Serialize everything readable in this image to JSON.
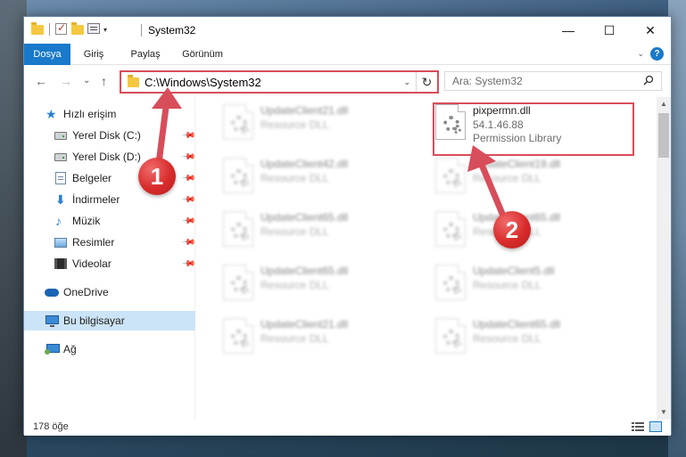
{
  "window": {
    "title": "System32",
    "controls": {
      "minimize": "—",
      "maximize": "☐",
      "close": "✕"
    }
  },
  "ribbon": {
    "tabs": [
      {
        "label": "Dosya",
        "active": true
      },
      {
        "label": "Giriş",
        "active": false
      },
      {
        "label": "Paylaş",
        "active": false
      },
      {
        "label": "Görünüm",
        "active": false
      }
    ],
    "help": "?"
  },
  "address": {
    "path": "C:\\Windows\\System32",
    "refresh": "↻",
    "dropdown": "⌄"
  },
  "search": {
    "placeholder": "Ara: System32"
  },
  "nav": {
    "back": "←",
    "forward": "→",
    "recent": "⌄",
    "up": "↑"
  },
  "sidebar": {
    "items": [
      {
        "label": "Hızlı erişim",
        "icon": "star-icon",
        "pinned": false
      },
      {
        "label": "Yerel Disk (C:)",
        "icon": "drive-icon",
        "pinned": true
      },
      {
        "label": "Yerel Disk (D:)",
        "icon": "drive-icon",
        "pinned": true
      },
      {
        "label": "Belgeler",
        "icon": "documents-icon",
        "pinned": true
      },
      {
        "label": "İndirmeler",
        "icon": "download-icon",
        "pinned": true
      },
      {
        "label": "Müzik",
        "icon": "music-icon",
        "pinned": true
      },
      {
        "label": "Resimler",
        "icon": "pictures-icon",
        "pinned": true
      },
      {
        "label": "Videolar",
        "icon": "videos-icon",
        "pinned": true
      },
      {
        "label": "OneDrive",
        "icon": "cloud-icon",
        "pinned": false
      },
      {
        "label": "Bu bilgisayar",
        "icon": "computer-icon",
        "pinned": false,
        "selected": true
      },
      {
        "label": "Ağ",
        "icon": "network-icon",
        "pinned": false
      }
    ]
  },
  "files": [
    {
      "name": "UpdateClient21.dll",
      "desc": "Resource DLL",
      "blurred": true
    },
    {
      "name": "pixpermn.dll",
      "version": "54.1.46.88",
      "desc": "Permission Library",
      "blurred": false
    },
    {
      "name": "UpdateClient42.dll",
      "desc": "Resource DLL",
      "blurred": true
    },
    {
      "name": "UpdateClient19.dll",
      "desc": "Resource DLL",
      "blurred": true
    },
    {
      "name": "UpdateClient65.dll",
      "desc": "Resource DLL",
      "blurred": true
    },
    {
      "name": "UpdateClient65.dll",
      "desc": "Resource DLL",
      "blurred": true
    },
    {
      "name": "UpdateClient65.dll",
      "desc": "Resource DLL",
      "blurred": true
    },
    {
      "name": "UpdateClient5.dll",
      "desc": "Resource DLL",
      "blurred": true
    },
    {
      "name": "UpdateClient21.dll",
      "desc": "Resource DLL",
      "blurred": true
    },
    {
      "name": "UpdateClient65.dll",
      "desc": "Resource DLL",
      "blurred": true
    }
  ],
  "status": {
    "count": "178 öğe"
  },
  "annotations": {
    "badge1": "1",
    "badge2": "2",
    "color": "#d84d5a"
  }
}
